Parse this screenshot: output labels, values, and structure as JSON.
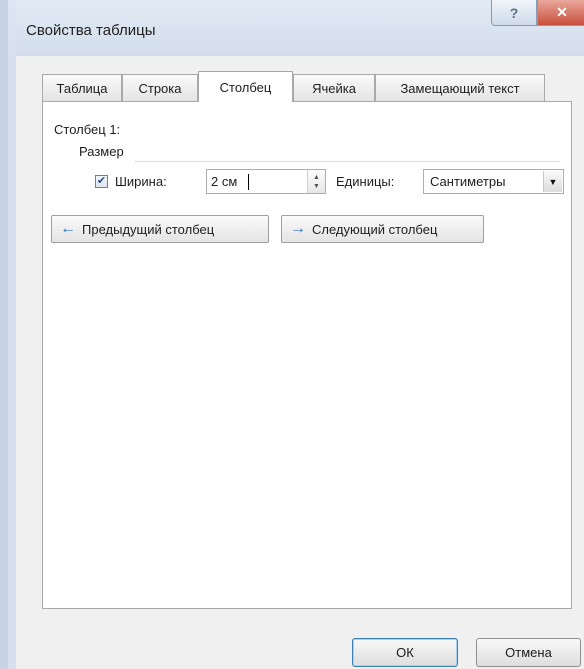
{
  "window": {
    "title": "Свойства таблицы",
    "help_label": "?",
    "close_label": "✕"
  },
  "tabs": [
    {
      "label": "Таблица",
      "active": false
    },
    {
      "label": "Строка",
      "active": false
    },
    {
      "label": "Столбец",
      "active": true
    },
    {
      "label": "Ячейка",
      "active": false
    },
    {
      "label": "Замещающий текст",
      "active": false
    }
  ],
  "column_panel": {
    "column_heading": "Столбец 1:",
    "size_group_label": "Размер",
    "width_checkbox": {
      "checked": true,
      "label": "Ширина:"
    },
    "width_value": "2 см",
    "units_label": "Единицы:",
    "units_value": "Сантиметры",
    "prev_button": "Предыдущий столбец",
    "next_button": "Следующий столбец"
  },
  "footer": {
    "ok_label": "ОК",
    "cancel_label": "Отмена"
  },
  "icons": {
    "prev": "arrow-left-icon",
    "next": "arrow-right-icon",
    "help": "help-icon",
    "close": "close-icon"
  },
  "colors": {
    "title_bar": "#d6e0ee",
    "close_button": "#c8503b",
    "arrow_blue": "#2f74c8"
  }
}
